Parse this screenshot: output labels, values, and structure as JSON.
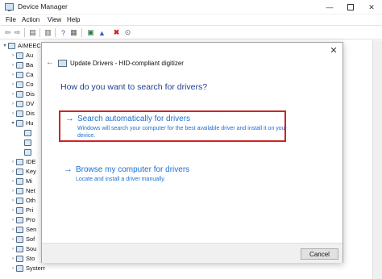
{
  "window": {
    "title": "Device Manager"
  },
  "menu": [
    "File",
    "Action",
    "View",
    "Help"
  ],
  "tree": {
    "root": "AIMEEC",
    "items": [
      "Au",
      "Ba",
      "Ca",
      "Co",
      "Dis",
      "DV",
      "Dis",
      "Hu",
      "",
      "",
      "",
      "IDE",
      "Key",
      "Mi",
      "Net",
      "Oth",
      "Pri",
      "Pro",
      "Sen",
      "Sof",
      "Sou",
      "Sto",
      "System devices"
    ]
  },
  "dialog": {
    "title": "Update Drivers - HID-compliant digitizer",
    "heading": "How do you want to search for drivers?",
    "options": [
      {
        "title": "Search automatically for drivers",
        "desc": "Windows will search your computer for the best available driver and install it on your device."
      },
      {
        "title": "Browse my computer for drivers",
        "desc": "Locate and install a driver manually."
      }
    ],
    "cancel_label": "Cancel"
  },
  "colors": {
    "link": "#1c6fd0",
    "heading": "#1e3d8f",
    "highlight_border": "#d12222"
  },
  "icons": [
    "app-icon",
    "back-arrow-icon",
    "forward-arrow-icon",
    "close-icon",
    "minimize-icon",
    "maximize-icon",
    "remove-icon",
    "update-driver-icon",
    "help-icon",
    "arrow-right-icon"
  ]
}
